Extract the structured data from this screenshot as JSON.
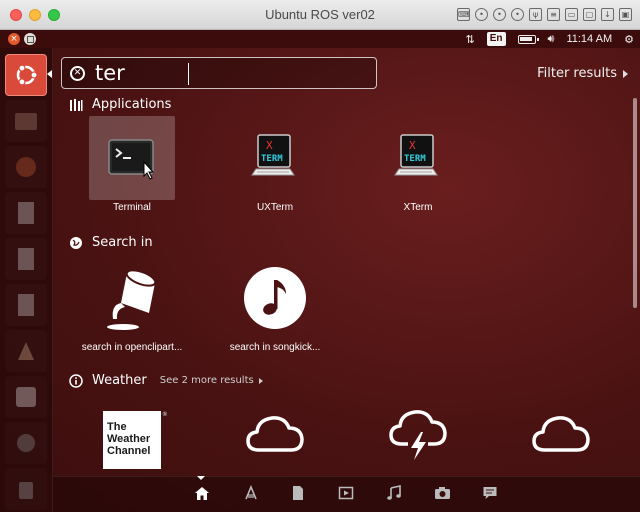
{
  "window": {
    "title": "Ubuntu ROS ver02"
  },
  "panel": {
    "keyboard_layout": "En",
    "time": "11:14 AM"
  },
  "search": {
    "query": "ter",
    "filter_label": "Filter results"
  },
  "categories": {
    "applications": {
      "label": "Applications"
    },
    "search_in": {
      "label": "Search in"
    },
    "weather": {
      "label": "Weather",
      "more": "See 2 more results"
    }
  },
  "applications": [
    {
      "label": "Terminal",
      "icon": "terminal-icon",
      "selected": true
    },
    {
      "label": "UXTerm",
      "icon": "xterm-icon"
    },
    {
      "label": "XTerm",
      "icon": "xterm-icon"
    }
  ],
  "search_in": [
    {
      "label": "search in openclipart...",
      "icon": "paint-bucket-icon"
    },
    {
      "label": "search in songkick...",
      "icon": "music-note-icon"
    }
  ],
  "weather": {
    "logo_lines": [
      "The",
      "Weather",
      "Channel"
    ],
    "icons": [
      "cloud-icon",
      "thunderstorm-icon",
      "cloud-icon"
    ]
  },
  "xterm_logo": {
    "x": "X",
    "term": "TERM"
  },
  "colors": {
    "dash_bg": "#4a1212",
    "launcher_bfb": "#d94a3b",
    "panel_bg": "#3c0b0b"
  }
}
